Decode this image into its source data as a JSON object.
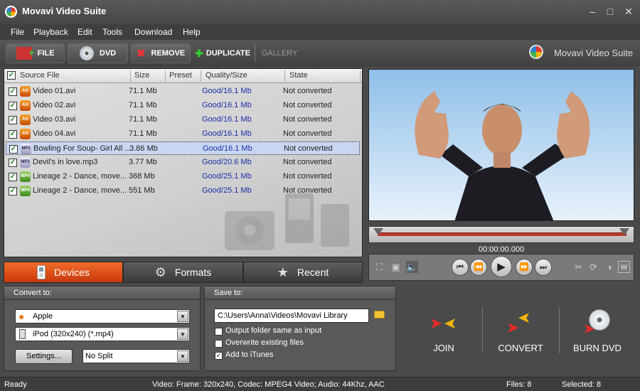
{
  "window": {
    "title": "Movavi Video Suite"
  },
  "menu": [
    "File",
    "Playback",
    "Edit",
    "Tools",
    "Download",
    "Help"
  ],
  "toolbar": {
    "file": "FILE",
    "dvd": "DVD",
    "remove": "REMOVE",
    "duplicate": "DUPLICATE",
    "gallery": "GALLERY",
    "brand": "Movavi Video Suite"
  },
  "list": {
    "headers": {
      "source": "Source File",
      "size": "Size",
      "preset": "Preset",
      "quality": "Quality/Size",
      "state": "State"
    },
    "rows": [
      {
        "name": "Video 01.avi",
        "size": "71.1 Mb",
        "quality": "Good/16.1 Mb",
        "state": "Not converted",
        "type": "AVI",
        "checked": true
      },
      {
        "name": "Video 02.avi",
        "size": "71.1 Mb",
        "quality": "Good/16.1 Mb",
        "state": "Not converted",
        "type": "AVI",
        "checked": true
      },
      {
        "name": "Video 03.avi",
        "size": "71.1 Mb",
        "quality": "Good/16.1 Mb",
        "state": "Not converted",
        "type": "AVI",
        "checked": true
      },
      {
        "name": "Video 04.avi",
        "size": "71.1 Mb",
        "quality": "Good/16.1 Mb",
        "state": "Not converted",
        "type": "AVI",
        "checked": true
      },
      {
        "name": "Bowling For Soup- Girl All ...",
        "size": "3.86 Mb",
        "quality": "Good/16.1 Mb",
        "state": "Not converted",
        "type": "MP3",
        "checked": true,
        "selected": true
      },
      {
        "name": "Devil's in love.mp3",
        "size": "3.77 Mb",
        "quality": "Good/20.6 Mb",
        "state": "Not converted",
        "type": "MP3",
        "checked": true
      },
      {
        "name": "Lineage 2 - Dance, move...",
        "size": "368 Mb",
        "quality": "Good/25.1 Mb",
        "state": "Not converted",
        "type": "MP4",
        "checked": true
      },
      {
        "name": "Lineage 2 - Dance, move...",
        "size": "551 Mb",
        "quality": "Good/25.1 Mb",
        "state": "Not converted",
        "type": "MP4",
        "checked": true
      }
    ]
  },
  "player": {
    "timecode": "00:00:00.000"
  },
  "tabs": {
    "devices": "Devices",
    "formats": "Formats",
    "recent": "Recent"
  },
  "convert": {
    "title": "Convert to:",
    "brand": "Apple",
    "device": "iPod (320x240) (*.mp4)",
    "settings": "Settings...",
    "split": "No Split"
  },
  "save": {
    "title": "Save to:",
    "path": "C:\\Users\\Anna\\Videos\\Movavi Library",
    "opt1": "Output folder same as input",
    "opt2": "Overwrite existing files",
    "opt3": "Add to iTunes",
    "opt1_checked": false,
    "opt2_checked": false,
    "opt3_checked": true
  },
  "actions": {
    "join": "JOIN",
    "convert": "CONVERT",
    "burn": "BURN DVD"
  },
  "status": {
    "ready": "Ready",
    "info": "Video: Frame: 320x240, Codec: MPEG4 Video; Audio: 44Khz, AAC",
    "files": "Files: 8",
    "selected": "Selected: 8"
  },
  "colors": {
    "accent": "#e4572e",
    "quality_link": "#1a2fa8",
    "timeline": "#c0392b"
  }
}
